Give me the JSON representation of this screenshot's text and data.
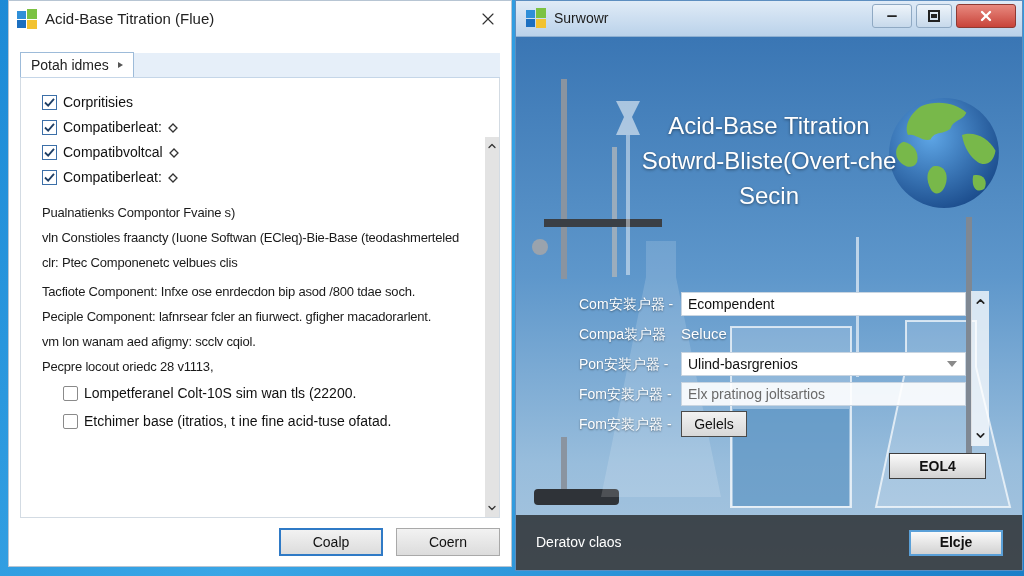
{
  "left_window": {
    "title": "Acid-Base Titration (Flue)",
    "tabs": [
      {
        "label": "Potah idmes",
        "selected": true
      }
    ],
    "options": [
      {
        "label": "Corpritisies",
        "checked": true,
        "kind": "plain"
      },
      {
        "label": "Compatiberleat:",
        "checked": true,
        "kind": "with_icon"
      },
      {
        "label": "Compatibvoltcal",
        "checked": true,
        "kind": "with_icon"
      },
      {
        "label": "Compatiberleat:",
        "checked": true,
        "kind": "with_icon"
      }
    ],
    "paragraph_groups": [
      {
        "lines": [
          "Pualnatienks Compontor Fvaine s)",
          "vln Constioles fraancty (Iuone Softwan (ECleq)-Bie-Base (teodashmerteled",
          "clr: Ptec Componenetc velbues clis"
        ]
      },
      {
        "lines": [
          "Tacfiote Component: Infxe ose enrdecdon bip asod /800 tdae soch.",
          "Peciple Component: lafnrsear fcler an fiurwect. gfigher macadorarlent.",
          "vm lon wanam aed afigmy: scclv cqiol.",
          "Pecpre locout oriedc 28 v1113,"
        ]
      }
    ],
    "sub_options": [
      {
        "label": "Lompetferanel Colt-10S sim wan tls (22200.",
        "checked": false
      },
      {
        "label": "Etchimer base (itratios, t ine fine acid-tuse ofatad.",
        "checked": false
      }
    ],
    "buttons": [
      {
        "label": "Coalp",
        "default": true
      },
      {
        "label": "Coern",
        "default": false
      }
    ]
  },
  "right_window": {
    "title": "Surwowr",
    "heading_lines": [
      "Acid-Base Titration",
      "Sotwrd-Bliste(Overt-che",
      "Secin"
    ],
    "form": [
      {
        "label": "Com安装户器 -",
        "kind": "input",
        "value": "Ecompendent"
      },
      {
        "label": "Compa装户器",
        "kind": "text",
        "value": "Seluce"
      },
      {
        "label": "Pon安装户器 -",
        "kind": "dropdown",
        "value": "Ulind-basrgrenios"
      },
      {
        "label": "Fom安装户器 -",
        "kind": "input",
        "placeholder": "Elx pratinog joltsartios"
      },
      {
        "label": "Fom安装户器 -",
        "kind": "button",
        "value": "Gelels"
      }
    ],
    "side_button": {
      "label": "EOL4",
      "default": false
    },
    "status_text": "Deratov claos",
    "footer_button": {
      "label": "Elcje",
      "default": true
    }
  }
}
